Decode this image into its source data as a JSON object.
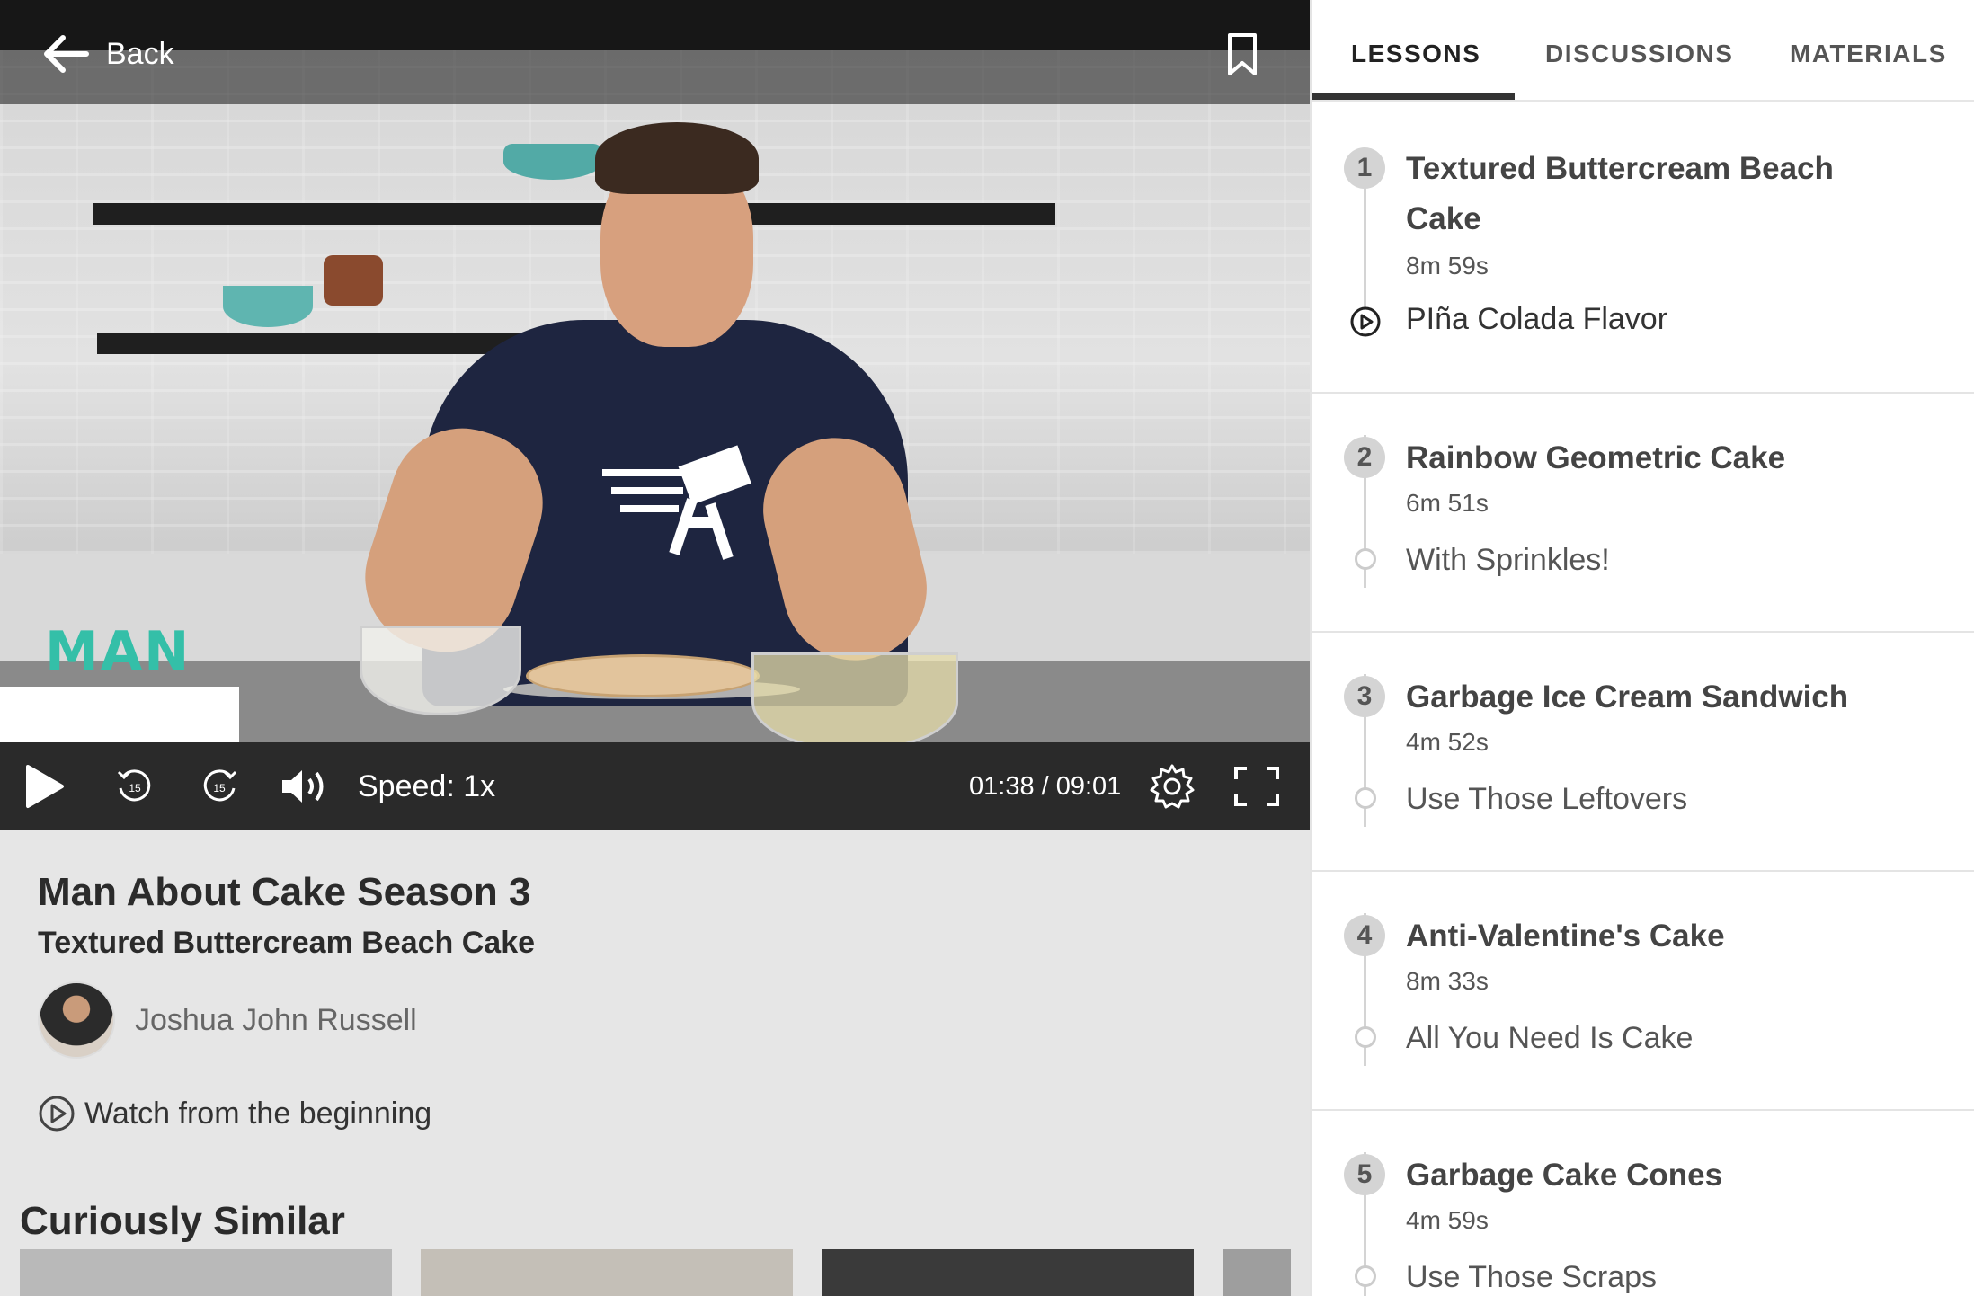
{
  "player": {
    "back_label": "Back",
    "speed_label": "Speed: 1x",
    "time_display": "01:38 / 09:01",
    "progress_fraction": 0.181,
    "rewind_seconds": "15",
    "forward_seconds": "15",
    "logo_text": "MAN"
  },
  "info": {
    "show_title": "Man About Cake Season 3",
    "episode_title": "Textured Buttercream Beach Cake",
    "author_name": "Joshua John Russell",
    "watch_label": "Watch from the beginning",
    "similar_heading": "Curiously Similar"
  },
  "tabs": [
    {
      "label": "LESSONS",
      "active": true
    },
    {
      "label": "DISCUSSIONS",
      "active": false
    },
    {
      "label": "MATERIALS",
      "active": false
    }
  ],
  "lessons": [
    {
      "number": "1",
      "title": "Textured Buttercream Beach Cake",
      "duration": "8m 59s",
      "subtitle": "PIña Colada Flavor",
      "current": true
    },
    {
      "number": "2",
      "title": "Rainbow Geometric Cake",
      "duration": "6m 51s",
      "subtitle": "With Sprinkles!",
      "current": false
    },
    {
      "number": "3",
      "title": "Garbage Ice Cream Sandwich",
      "duration": "4m 52s",
      "subtitle": "Use Those Leftovers",
      "current": false
    },
    {
      "number": "4",
      "title": "Anti-Valentine's Cake",
      "duration": "8m 33s",
      "subtitle": "All You Need Is Cake",
      "current": false
    },
    {
      "number": "5",
      "title": "Garbage Cake Cones",
      "duration": "4m 59s",
      "subtitle": "Use Those Scraps",
      "current": false
    }
  ],
  "icons": {
    "back": "arrow-left-icon",
    "bookmark": "bookmark-icon",
    "play": "play-icon",
    "rewind": "rewind-15-icon",
    "forward": "forward-15-icon",
    "volume": "volume-icon",
    "settings": "gear-icon",
    "fullscreen": "fullscreen-icon"
  }
}
